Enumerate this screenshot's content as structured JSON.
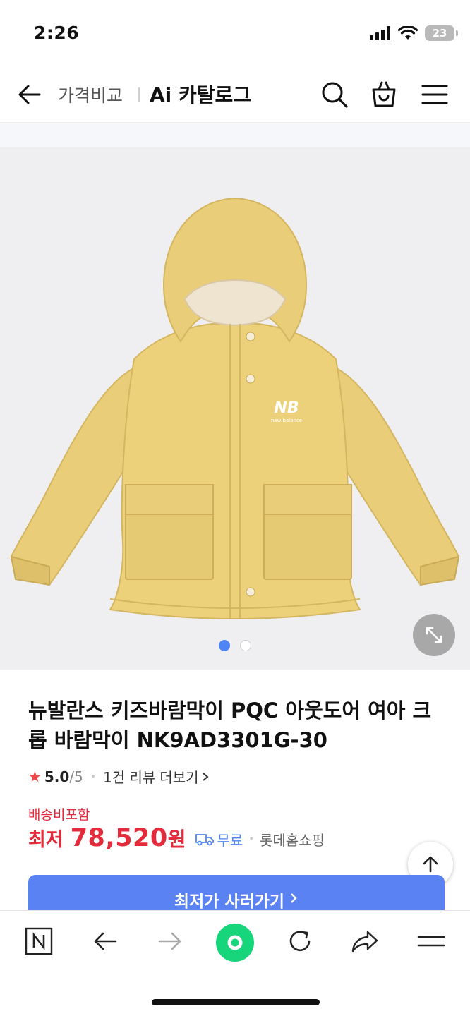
{
  "status": {
    "time": "2:26",
    "battery": "23"
  },
  "header": {
    "sub_title": "가격비교",
    "main_title": "Ai 카탈로그",
    "icons": [
      "back-arrow-icon",
      "search-icon",
      "shopping-bag-icon",
      "hamburger-menu-icon"
    ]
  },
  "gallery": {
    "current_page": 1,
    "total_pages": 2,
    "logo_text": "new balance"
  },
  "product": {
    "title": "뉴발란스 키즈바람막이 PQC 아웃도어 여아 크롭 바람막이 NK9AD3301G-30",
    "rating": "5.0",
    "rating_max": "/5",
    "review_count": "1건 리뷰",
    "review_more": "더보기",
    "shipping_included": "배송비포함",
    "price_prefix": "최저",
    "price_value": "78,520",
    "price_unit": "원",
    "delivery_label": "무료",
    "seller": "롯데홈쇼핑",
    "cta_label": "최저가 사러가기"
  },
  "bottom_nav": {
    "icons": [
      "naver-n-icon",
      "back-icon",
      "forward-icon",
      "home-green-icon",
      "reload-icon",
      "share-icon",
      "more-menu-icon"
    ]
  },
  "colors": {
    "accent_red": "#e32b3c",
    "accent_blue": "#5b82f2",
    "naver_green": "#17d57a",
    "jacket_yellow": "#ecd07a"
  }
}
